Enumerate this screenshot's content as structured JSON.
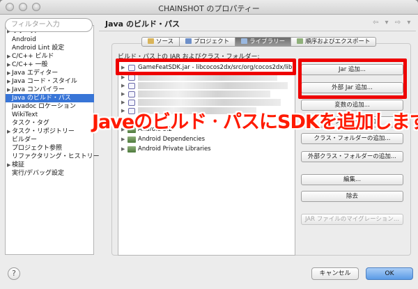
{
  "window": {
    "title": "CHAINSHOT のプロパティー"
  },
  "sidebar": {
    "filter_placeholder": "フィルター入力",
    "items": [
      {
        "label": "リソース",
        "arrow": "▶"
      },
      {
        "label": "Android",
        "arrow": ""
      },
      {
        "label": "Android Lint 設定",
        "arrow": ""
      },
      {
        "label": "C/C++ ビルド",
        "arrow": "▶"
      },
      {
        "label": "C/C++ 一般",
        "arrow": "▶"
      },
      {
        "label": "Java エディター",
        "arrow": "▶"
      },
      {
        "label": "Java コード・スタイル",
        "arrow": "▶"
      },
      {
        "label": "Java コンパイラー",
        "arrow": "▶"
      },
      {
        "label": "Java のビルド・パス",
        "arrow": "",
        "selected": true
      },
      {
        "label": "Javadoc ロケーション",
        "arrow": ""
      },
      {
        "label": "WikiText",
        "arrow": ""
      },
      {
        "label": "タスク・タグ",
        "arrow": ""
      },
      {
        "label": "タスク・リポジトリー",
        "arrow": "▶"
      },
      {
        "label": "ビルダー",
        "arrow": ""
      },
      {
        "label": "プロジェクト参照",
        "arrow": ""
      },
      {
        "label": "リファクタリング・ヒストリー",
        "arrow": ""
      },
      {
        "label": "検証",
        "arrow": "▶"
      },
      {
        "label": "実行/デバッグ設定",
        "arrow": ""
      }
    ]
  },
  "panel": {
    "title": "Java のビルド・パス",
    "nav_arrows": "⇦ ▾ ⇨ ▾"
  },
  "tabs": [
    {
      "label": "ソース",
      "active": false
    },
    {
      "label": "プロジェクト",
      "active": false
    },
    {
      "label": "ライブラリー",
      "active": true
    },
    {
      "label": "順序およびエクスポート",
      "active": false
    }
  ],
  "libraries": {
    "label": "ビルド・パス上の JAR およびクラス・フォルダー:",
    "entries": [
      {
        "text": "GameFeatSDK.jar - libcocos2dx/src/org/cocos2dx/lib",
        "icon": "jar-icon",
        "arrow": "▶"
      },
      {
        "text": "",
        "icon": "jar-icon",
        "arrow": "▶"
      },
      {
        "text": "",
        "icon": "jar-icon",
        "arrow": "▶"
      },
      {
        "text": "",
        "icon": "jar-icon",
        "arrow": "▶"
      },
      {
        "text": "",
        "icon": "jar-icon",
        "arrow": "▶"
      },
      {
        "text": "",
        "icon": "jar-icon",
        "arrow": "▶"
      },
      {
        "text": "Android 3.2",
        "icon": "library-icon",
        "arrow": "▶"
      },
      {
        "text": "Android Dependencies",
        "icon": "library-icon",
        "arrow": "▶"
      },
      {
        "text": "Android Private Libraries",
        "icon": "library-icon",
        "arrow": "▶"
      }
    ]
  },
  "buttons": {
    "add_jar": "Jar 追加...",
    "add_external_jar": "外部 Jar 追加...",
    "add_variable": "変数の追加...",
    "add_library": "ライブラリーの追加...",
    "add_class_folder": "クラス・フォルダーの追加...",
    "add_external_class_folder": "外部クラス・フォルダーの追加...",
    "edit": "編集...",
    "remove": "除去",
    "migrate_jar": "JAR ファイルのマイグレーション..."
  },
  "annotation": {
    "text": "JaveのビルドㆍパスにSDKを追加します。",
    "color": "#ff1a00"
  },
  "footer": {
    "help": "?",
    "cancel": "キャンセル",
    "ok": "OK"
  },
  "colors": {
    "selection": "#3875d7",
    "highlight_border": "#ee0000",
    "ok_button": "#5b9be6"
  }
}
